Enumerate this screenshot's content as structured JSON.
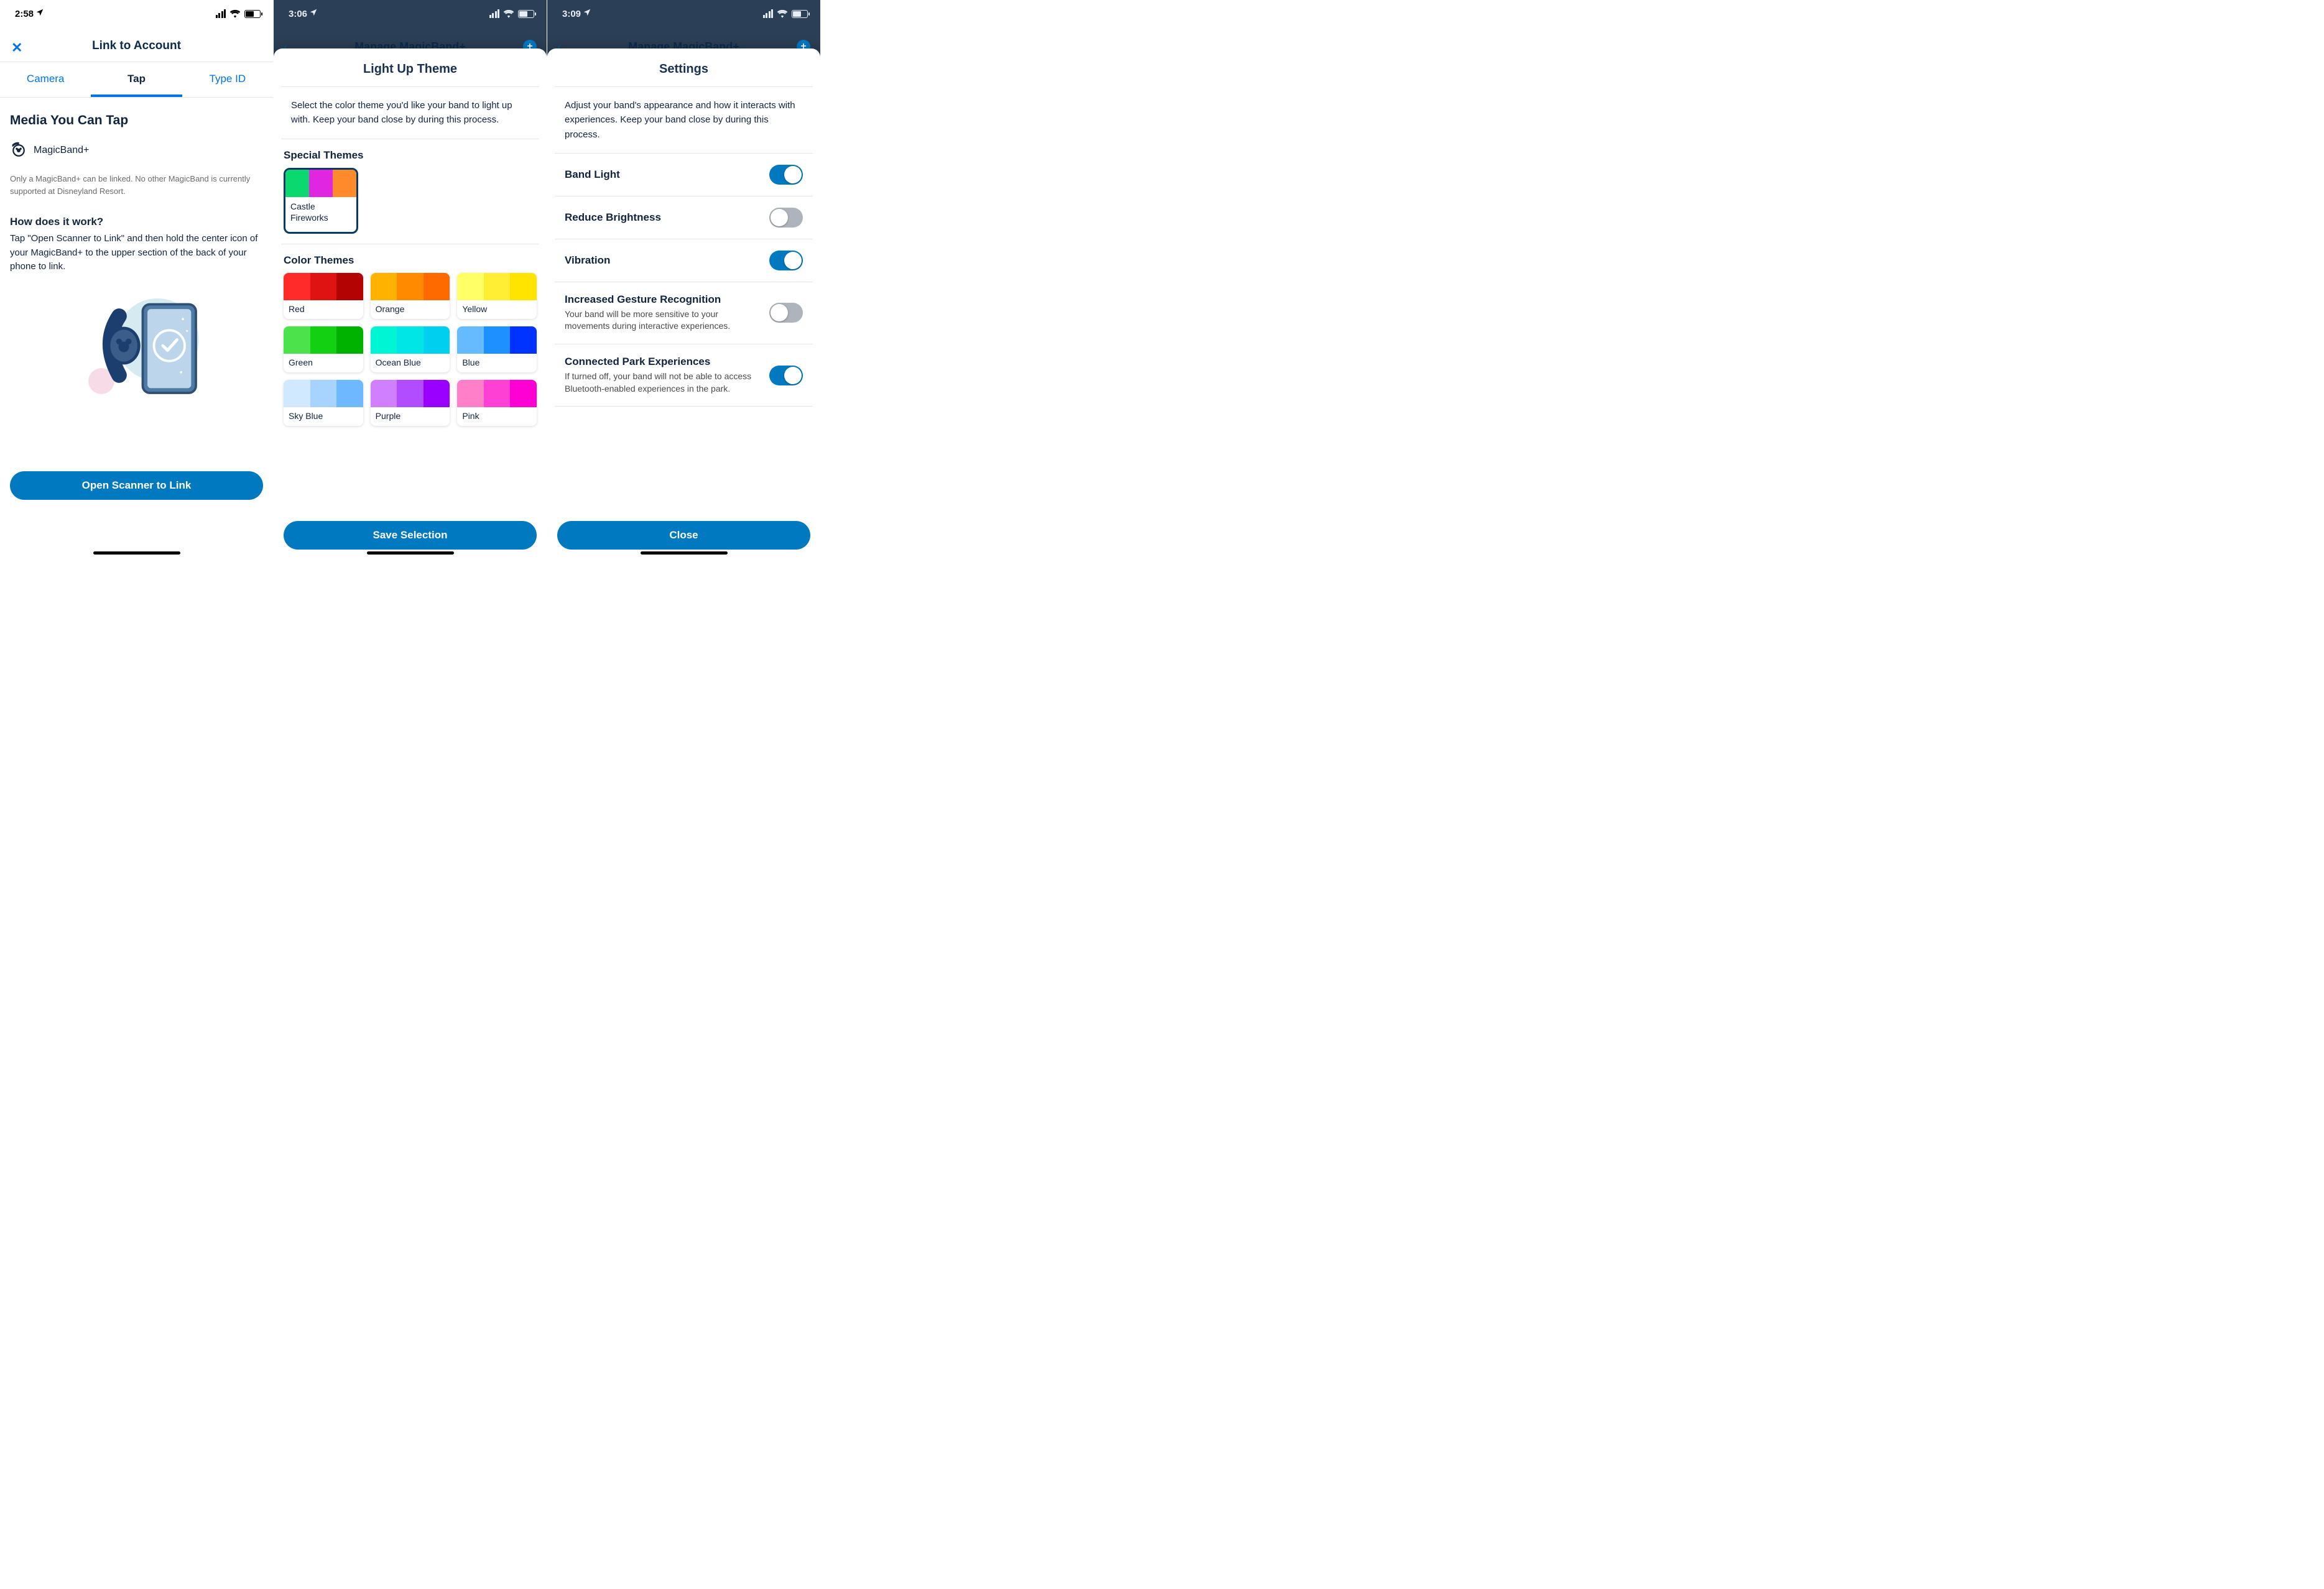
{
  "screen1": {
    "status_time": "2:58",
    "nav_title": "Link to Account",
    "tabs": [
      "Camera",
      "Tap",
      "Type ID"
    ],
    "active_tab_index": 1,
    "section_heading": "Media You Can Tap",
    "media_item": "MagicBand+",
    "hint": "Only a MagicBand+ can be linked. No other MagicBand is currently supported at Disneyland Resort.",
    "how_heading": "How does it work?",
    "how_text": "Tap \"Open Scanner to Link\" and then hold the center icon of your MagicBand+ to the upper section of the back of your phone to link.",
    "primary_button": "Open Scanner to Link"
  },
  "screen2": {
    "status_time": "3:06",
    "back_title": "Manage MagicBand+",
    "sheet_title": "Light Up Theme",
    "intro": "Select the color theme you'd like your band to light up with. Keep your band close by during this process.",
    "special_heading": "Special Themes",
    "special_theme": {
      "name": "Castle Fireworks",
      "colors": [
        "#0cd870",
        "#e026e0",
        "#ff8a2b"
      ],
      "selected": true
    },
    "color_heading": "Color Themes",
    "color_themes": [
      {
        "name": "Red",
        "colors": [
          "#ff2a2a",
          "#e01313",
          "#b30303"
        ]
      },
      {
        "name": "Orange",
        "colors": [
          "#ffb300",
          "#ff8a00",
          "#ff6a00"
        ]
      },
      {
        "name": "Yellow",
        "colors": [
          "#ffff66",
          "#ffee33",
          "#ffe400"
        ]
      },
      {
        "name": "Green",
        "colors": [
          "#4be24b",
          "#13d013",
          "#00b200"
        ]
      },
      {
        "name": "Ocean Blue",
        "colors": [
          "#00f5d4",
          "#00e6e6",
          "#00cff0"
        ]
      },
      {
        "name": "Blue",
        "colors": [
          "#66bbff",
          "#1e90ff",
          "#0033ff"
        ]
      },
      {
        "name": "Sky Blue",
        "colors": [
          "#d0e9ff",
          "#a6d3ff",
          "#6db8ff"
        ]
      },
      {
        "name": "Purple",
        "colors": [
          "#d080ff",
          "#b24dff",
          "#9900ff"
        ]
      },
      {
        "name": "Pink",
        "colors": [
          "#ff80c8",
          "#ff40d4",
          "#ff00d4"
        ]
      }
    ],
    "primary_button": "Save Selection"
  },
  "screen3": {
    "status_time": "3:09",
    "back_title": "Manage MagicBand+",
    "sheet_title": "Settings",
    "intro": "Adjust your band's appearance and how it interacts with experiences. Keep your band close by during this process.",
    "settings": [
      {
        "title": "Band Light",
        "on": true
      },
      {
        "title": "Reduce Brightness",
        "on": false
      },
      {
        "title": "Vibration",
        "on": true
      },
      {
        "title": "Increased Gesture Recognition",
        "desc": "Your band will be more sensitive to your movements during interactive experiences.",
        "on": false
      },
      {
        "title": "Connected Park Experiences",
        "desc": "If turned off, your band will not be able to access Bluetooth-enabled experiences in the park.",
        "on": true
      }
    ],
    "primary_button": "Close"
  }
}
